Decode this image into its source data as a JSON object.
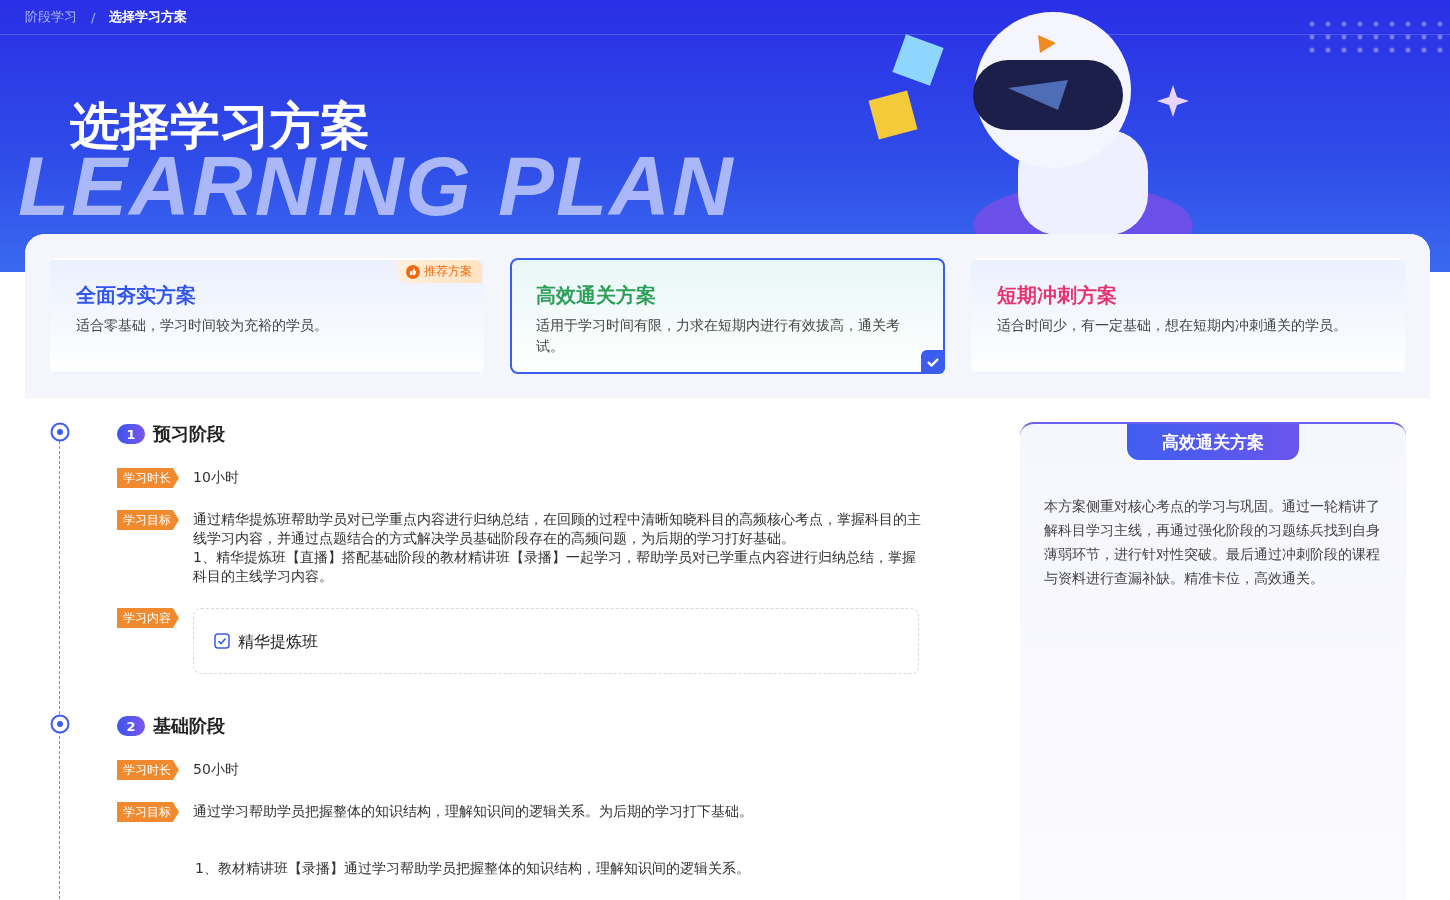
{
  "breadcrumb": [
    {
      "label": "阶段学习",
      "selected": false
    },
    {
      "label": "选择学习方案",
      "selected": true
    }
  ],
  "breadcrumb_separator": "/",
  "hero": {
    "title": "选择学习方案",
    "background_text": "LEARNING PLAN"
  },
  "plans": [
    {
      "title": "全面夯实方案",
      "description": "适合零基础，学习时间较为充裕的学员。",
      "color": "#3355ee",
      "selected": false,
      "badge": "推荐方案"
    },
    {
      "title": "高效通关方案",
      "description": "适用于学习时间有限，力求在短期内进行有效拔高，通关考试。",
      "color": "#2e9e5b",
      "selected": true
    },
    {
      "title": "短期冲刺方案",
      "description": "适合时间少，有一定基础，想在短期内冲刺通关的学员。",
      "color": "#e8336f",
      "selected": false
    }
  ],
  "stages": [
    {
      "number": "1",
      "title": "预习阶段",
      "items": [
        {
          "kind": "text",
          "tag": "学习时长",
          "lines": [
            "10小时"
          ]
        },
        {
          "kind": "text",
          "tag": "学习目标",
          "lines": [
            "通过精华提炼班帮助学员对已学重点内容进行归纳总结，在回顾的过程中清晰知晓科目的高频核心考点，掌握科目的主线学习内容，并通过点题结合的方式解决学员基础阶段存在的高频问题，为后期的学习打好基础。",
            "1、精华提炼班【直播】搭配基础阶段的教材精讲班【录播】一起学习，帮助学员对已学重点内容进行归纳总结，掌握科目的主线学习内容。"
          ]
        },
        {
          "kind": "content",
          "tag": "学习内容",
          "courses": [
            {
              "name": "精华提炼班",
              "checked": true
            }
          ]
        }
      ]
    },
    {
      "number": "2",
      "title": "基础阶段",
      "items": [
        {
          "kind": "text",
          "tag": "学习时长",
          "lines": [
            "50小时"
          ]
        },
        {
          "kind": "text",
          "tag": "学习目标",
          "lines": [
            "通过学习帮助学员把握整体的知识结构，理解知识间的逻辑关系。为后期的学习打下基础。"
          ]
        },
        {
          "kind": "note",
          "lines": [
            "1、教材精讲班【录播】通过学习帮助学员把握整体的知识结构，理解知识间的逻辑关系。"
          ]
        }
      ]
    }
  ],
  "summary": {
    "title": "高效通关方案",
    "text": "本方案侧重对核心考点的学习与巩固。通过一轮精讲了解科目学习主线，再通过强化阶段的习题练兵找到自身薄弱环节，进行针对性突破。最后通过冲刺阶段的课程与资料进行查漏补缺。精准卡位，高效通关。"
  }
}
